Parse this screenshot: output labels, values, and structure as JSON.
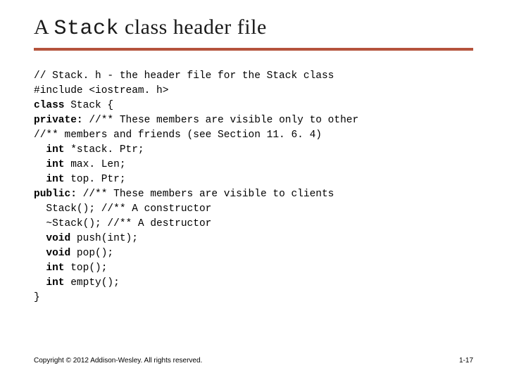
{
  "title": {
    "prefix": "A ",
    "mono": "Stack",
    "suffix": " class header file"
  },
  "code": {
    "l1": "// Stack. h - the header file for the Stack class",
    "l2": "#include <iostream. h>",
    "l3a": "class",
    "l3b": " Stack {",
    "l4a": "private:",
    "l4b": " //** These members are visible only to other",
    "l5": "//** members and friends (see Section 11. 6. 4)",
    "l6a": "  int",
    "l6b": " *stack. Ptr;",
    "l7a": "  int",
    "l7b": " max. Len;",
    "l8a": "  int",
    "l8b": " top. Ptr;",
    "l9a": "public:",
    "l9b": " //** These members are visible to clients",
    "l10": "  Stack(); //** A constructor",
    "l11": "  ~Stack(); //** A destructor",
    "l12a": "  void",
    "l12b": " push(int);",
    "l13a": "  void",
    "l13b": " pop();",
    "l14a": "  int",
    "l14b": " top();",
    "l15a": "  int",
    "l15b": " empty();",
    "l16": "}"
  },
  "footer": {
    "copyright": "Copyright © 2012 Addison-Wesley. All rights reserved.",
    "pagenum": "1-17"
  }
}
